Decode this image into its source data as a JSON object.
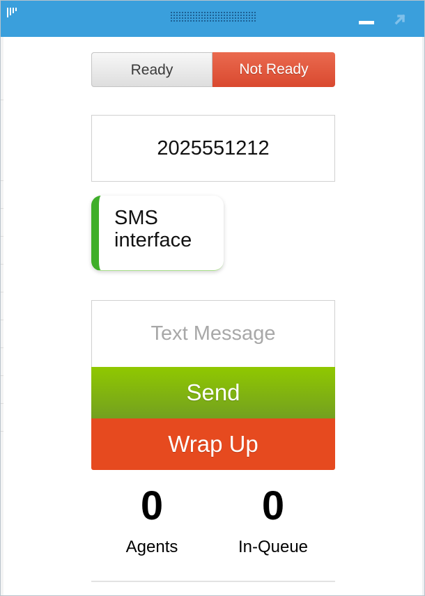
{
  "titlebar": {
    "color": "#3a9fdc",
    "logo_icon": "bars-logo-icon",
    "grip_icon": "drag-grip-icon",
    "minimize_icon": "minimize-icon",
    "popout_icon": "popout-arrow-icon"
  },
  "status_toggle": {
    "ready_label": "Ready",
    "not_ready_label": "Not Ready",
    "selected": "Not Ready",
    "selected_color": "#e35a3f"
  },
  "phone_number": "2025551212",
  "channel": {
    "label": "SMS interface",
    "accent_color": "#3fae2a"
  },
  "message": {
    "placeholder": "Text Message",
    "value": ""
  },
  "actions": {
    "send_label": "Send",
    "send_color": "#84b80f",
    "wrap_up_label": "Wrap Up",
    "wrap_up_color": "#e64a1f"
  },
  "stats": {
    "agents_count": "0",
    "agents_label": "Agents",
    "queue_count": "0",
    "queue_label": "In-Queue"
  }
}
